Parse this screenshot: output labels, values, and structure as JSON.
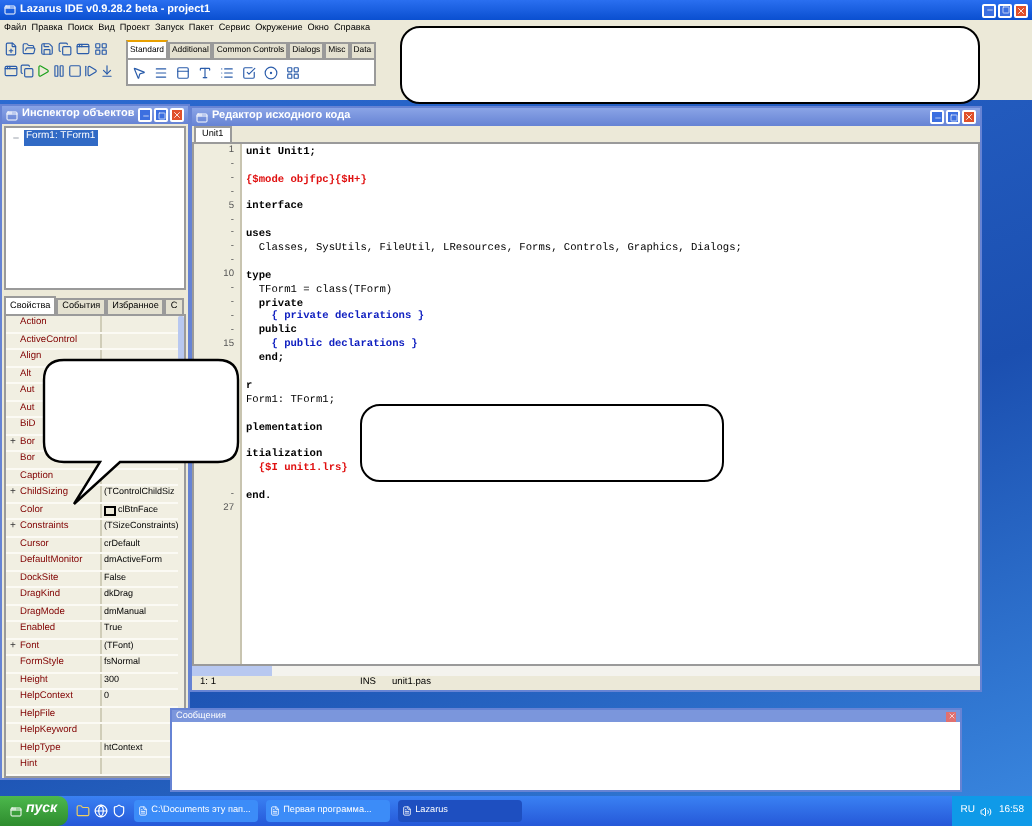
{
  "ide_window": {
    "title": "Lazarus IDE v0.9.28.2 beta - project1",
    "menu": [
      "Файл",
      "Правка",
      "Поиск",
      "Вид",
      "Проект",
      "Запуск",
      "Пакет",
      "Сервис",
      "Окружение",
      "Окно",
      "Справка"
    ],
    "palette_tabs": [
      {
        "label": "Standard",
        "selected": true
      },
      {
        "label": "Additional",
        "selected": false
      },
      {
        "label": "Common Controls",
        "selected": false
      },
      {
        "label": "Dialogs",
        "selected": false
      },
      {
        "label": "Misc",
        "selected": false
      },
      {
        "label": "Data",
        "selected": false
      }
    ]
  },
  "object_inspector": {
    "title": "Инспектор объектов",
    "tree": [
      {
        "label": "Form1: TForm1",
        "selected": true
      }
    ],
    "tabs": [
      {
        "label": "Свойства",
        "selected": true
      },
      {
        "label": "События",
        "selected": false
      },
      {
        "label": "Избранное",
        "selected": false
      },
      {
        "label": "С",
        "selected": false
      }
    ],
    "properties": [
      {
        "name": "Action"
      },
      {
        "name": "ActiveControl"
      },
      {
        "name": "Align"
      },
      {
        "name": "Alt"
      },
      {
        "name": "Aut"
      },
      {
        "name": "Aut"
      },
      {
        "name": "BiD"
      },
      {
        "name": "Bor",
        "expander": "+"
      },
      {
        "name": "Bor"
      },
      {
        "name": "Caption"
      },
      {
        "name": "ChildSizing",
        "value": "(TControlChildSiz",
        "expander": "+"
      },
      {
        "name": "Color",
        "value": "clBtnFace",
        "color": "#ece9d8"
      },
      {
        "name": "Constraints",
        "value": "(TSizeConstraints)",
        "expander": "+"
      },
      {
        "name": "Cursor",
        "value": "crDefault"
      },
      {
        "name": "DefaultMonitor",
        "value": "dmActiveForm"
      },
      {
        "name": "DockSite",
        "value": "False"
      },
      {
        "name": "DragKind",
        "value": "dkDrag"
      },
      {
        "name": "DragMode",
        "value": "dmManual"
      },
      {
        "name": "Enabled",
        "value": "True"
      },
      {
        "name": "Font",
        "value": "(TFont)",
        "expander": "+"
      },
      {
        "name": "FormStyle",
        "value": "fsNormal"
      },
      {
        "name": "Height",
        "value": "300"
      },
      {
        "name": "HelpContext",
        "value": "0"
      },
      {
        "name": "HelpFile"
      },
      {
        "name": "HelpKeyword"
      },
      {
        "name": "HelpType",
        "value": "htContext"
      },
      {
        "name": "Hint"
      }
    ]
  },
  "source_editor": {
    "title": "Редактор исходного кода",
    "tabs": [
      {
        "label": "Unit1",
        "selected": true
      }
    ],
    "lines": [
      {
        "gutter": "1",
        "text": "unit Unit1;",
        "kind": "keyword"
      },
      {
        "gutter": "-"
      },
      {
        "gutter": "-",
        "text": "{$mode objfpc}{$H+}",
        "kind": "directive"
      },
      {
        "gutter": "-"
      },
      {
        "gutter": "5",
        "text": "interface",
        "kind": "keyword"
      },
      {
        "gutter": "-"
      },
      {
        "gutter": "-",
        "text": "uses",
        "kind": "keyword"
      },
      {
        "gutter": "-",
        "text": "  Classes, SysUtils, FileUtil, LResources, Forms, Controls, Graphics, Dialogs;",
        "kind": "code"
      },
      {
        "gutter": "-"
      },
      {
        "gutter": "10",
        "text": "type",
        "kind": "keyword"
      },
      {
        "gutter": "-",
        "text": "  TForm1 = class(TForm)",
        "kind": "code"
      },
      {
        "gutter": "-",
        "text": "  private",
        "kind": "keyword"
      },
      {
        "gutter": "-",
        "text": "    { private declarations }",
        "kind": "comment"
      },
      {
        "gutter": "-",
        "text": "  public",
        "kind": "keyword"
      },
      {
        "gutter": "15",
        "text": "    { public declarations }",
        "kind": "comment"
      },
      {
        "text": "  end;",
        "kind": "keyword"
      },
      {
        "kind": "blank"
      },
      {
        "text": "r",
        "kind": "keyword"
      },
      {
        "text": "Form1: TForm1;",
        "kind": "code"
      },
      {
        "kind": "blank"
      },
      {
        "text": "plementation",
        "kind": "keyword"
      },
      {
        "kind": "blank"
      },
      {
        "text": "itialization",
        "kind": "keyword"
      },
      {
        "text": "  {$I unit1.lrs}",
        "kind": "directive"
      },
      {
        "kind": "blank"
      },
      {
        "gutter": "-",
        "text": "end.",
        "kind": "keyword"
      },
      {
        "gutter": "27"
      }
    ],
    "status": [
      "1: 1",
      "INS",
      "unit1.pas"
    ]
  },
  "messages": {
    "title": "Сообщения"
  },
  "taskbar": {
    "start": "пуск",
    "tasks": [
      {
        "label": "C:\\Documents эту пап...",
        "selected": false
      },
      {
        "label": "Первая программа...",
        "selected": false
      },
      {
        "label": "Lazarus",
        "selected": true
      }
    ],
    "language": "RU",
    "clock": "16:58"
  }
}
